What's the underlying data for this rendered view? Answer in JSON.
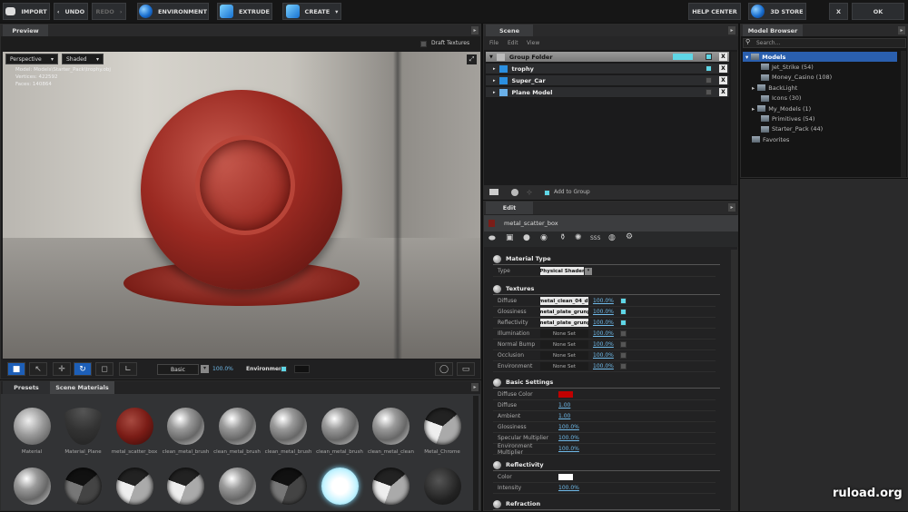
{
  "toolbar": {
    "import": "IMPORT",
    "undo": "UNDO",
    "redo": "REDO",
    "environment": "ENVIRONMENT",
    "extrude": "EXTRUDE",
    "create": "CREATE",
    "help": "HELP CENTER",
    "store": "3D STORE",
    "close": "X",
    "ok": "OK"
  },
  "preview": {
    "tab": "Preview",
    "draft_textures": "Draft Textures",
    "camera": "Perspective",
    "shading": "Shaded",
    "model": "Model: Models\\Starter_Pack\\trophy.obj",
    "vertices": "Vertices: 422592",
    "faces": "Faces: 140864",
    "render_mode": "Basic",
    "render_pct": "100.0%",
    "environment": "Environment"
  },
  "scene": {
    "tab": "Scene",
    "menu": [
      "File",
      "Edit",
      "View"
    ],
    "rows": [
      {
        "name": "Group Folder"
      },
      {
        "name": "trophy"
      },
      {
        "name": "Super_Car"
      },
      {
        "name": "Plane Model"
      }
    ],
    "add_to_group": "Add to Group"
  },
  "browser": {
    "tab": "Model Browser",
    "search_placeholder": "Search...",
    "items": [
      "Models",
      "Jet_Strike (54)",
      "Money_Casino (108)",
      "BackLight",
      "Icons (30)",
      "My_Models (1)",
      "Primitives (54)",
      "Starter_Pack (44)",
      "Favorites"
    ]
  },
  "edit": {
    "tab": "Edit",
    "material_name": "metal_scatter_box",
    "material_type": {
      "title": "Material Type",
      "label": "Type",
      "value": "Physical Shader"
    },
    "textures": {
      "title": "Textures",
      "rows": [
        {
          "label": "Diffuse",
          "file": "metal_clean_04_di",
          "pct": "100.0%",
          "on": true
        },
        {
          "label": "Glossiness",
          "file": "metal_plate_grung",
          "pct": "100.0%",
          "on": true
        },
        {
          "label": "Reflectivity",
          "file": "metal_plate_grung",
          "pct": "100.0%",
          "on": true
        },
        {
          "label": "Illumination",
          "file": "None Set",
          "pct": "100.0%",
          "on": false
        },
        {
          "label": "Normal Bump",
          "file": "None Set",
          "pct": "100.0%",
          "on": false
        },
        {
          "label": "Occlusion",
          "file": "None Set",
          "pct": "100.0%",
          "on": false
        },
        {
          "label": "Environment",
          "file": "None Set",
          "pct": "100.0%",
          "on": false
        }
      ]
    },
    "basic": {
      "title": "Basic Settings",
      "diffuse_color_label": "Diffuse Color",
      "diffuse_color": "#c00000",
      "rows": [
        {
          "label": "Diffuse",
          "value": "1.00"
        },
        {
          "label": "Ambient",
          "value": "1.00"
        },
        {
          "label": "Glossiness",
          "value": "100.0%"
        },
        {
          "label": "Specular Multiplier",
          "value": "100.0%"
        },
        {
          "label": "Environment Multiplier",
          "value": "100.0%"
        }
      ]
    },
    "reflectivity": {
      "title": "Reflectivity",
      "color_label": "Color",
      "color": "#ffffff",
      "intensity_label": "Intensity",
      "intensity": "100.0%"
    },
    "refraction": {
      "title": "Refraction"
    }
  },
  "materials": {
    "tabs": [
      "Presets",
      "Scene Materials"
    ],
    "items": [
      {
        "label": "Material",
        "style": "material"
      },
      {
        "label": "Material_Plane",
        "style": "plane"
      },
      {
        "label": "metal_scatter_box",
        "style": "red"
      },
      {
        "label": "clean_metal_brush",
        "style": "brushed"
      },
      {
        "label": "clean_metal_brush",
        "style": "brushed"
      },
      {
        "label": "clean_metal_brush",
        "style": "brushed"
      },
      {
        "label": "clean_metal_brush",
        "style": "brushed"
      },
      {
        "label": "clean_metal_clean",
        "style": "brushed"
      },
      {
        "label": "Metal_Chrome",
        "style": "split"
      },
      {
        "label": "",
        "style": "brushed"
      },
      {
        "label": "",
        "style": "darksplit"
      },
      {
        "label": "",
        "style": "split"
      },
      {
        "label": "",
        "style": "split"
      },
      {
        "label": "",
        "style": "brushed"
      },
      {
        "label": "",
        "style": "darksplit"
      },
      {
        "label": "",
        "style": "glow"
      },
      {
        "label": "",
        "style": "split"
      },
      {
        "label": "",
        "style": "dark"
      }
    ]
  },
  "watermark": "ruload.org"
}
